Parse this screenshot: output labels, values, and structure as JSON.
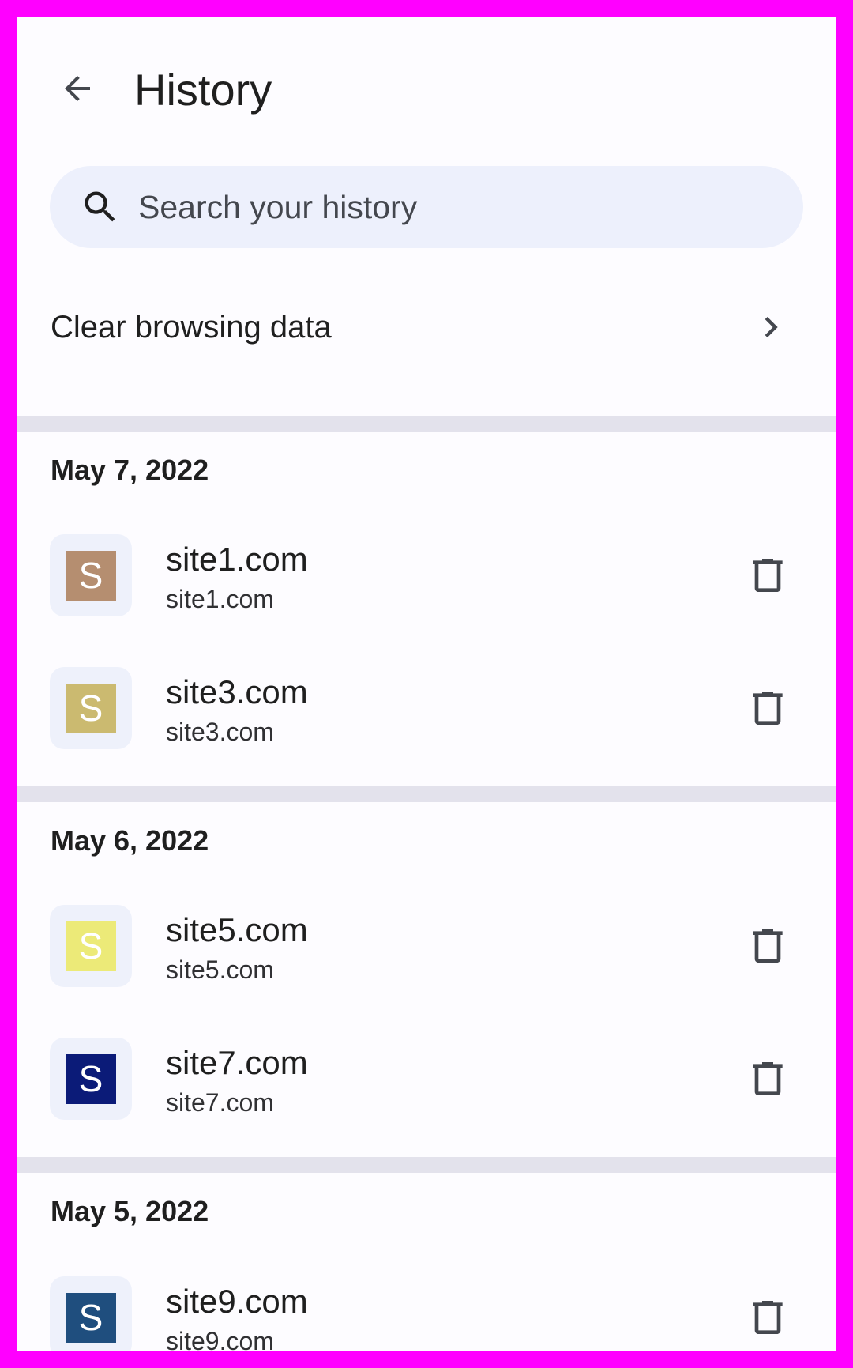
{
  "header": {
    "title": "History",
    "back_icon": "arrow-back-icon"
  },
  "search": {
    "placeholder": "Search your history",
    "value": "",
    "icon": "search-icon"
  },
  "clear_data": {
    "label": "Clear browsing data",
    "icon": "chevron-right-icon"
  },
  "groups": [
    {
      "date": "May 7, 2022",
      "entries": [
        {
          "title": "site1.com",
          "url": "site1.com",
          "favicon_letter": "S",
          "favicon_color": "#b58e70"
        },
        {
          "title": "site3.com",
          "url": "site3.com",
          "favicon_letter": "S",
          "favicon_color": "#cbba70"
        }
      ]
    },
    {
      "date": "May 6, 2022",
      "entries": [
        {
          "title": "site5.com",
          "url": "site5.com",
          "favicon_letter": "S",
          "favicon_color": "#ecea78"
        },
        {
          "title": "site7.com",
          "url": "site7.com",
          "favicon_letter": "S",
          "favicon_color": "#0b1b78"
        }
      ]
    },
    {
      "date": "May 5, 2022",
      "entries": [
        {
          "title": "site9.com",
          "url": "site9.com",
          "favicon_letter": "S",
          "favicon_color": "#1f4e7e"
        }
      ]
    }
  ],
  "colors": {
    "frame": "#ff00ff",
    "background": "#fdfcff",
    "search_background": "#edf0fc",
    "divider": "#e3e2ec",
    "icon": "#44474e"
  }
}
